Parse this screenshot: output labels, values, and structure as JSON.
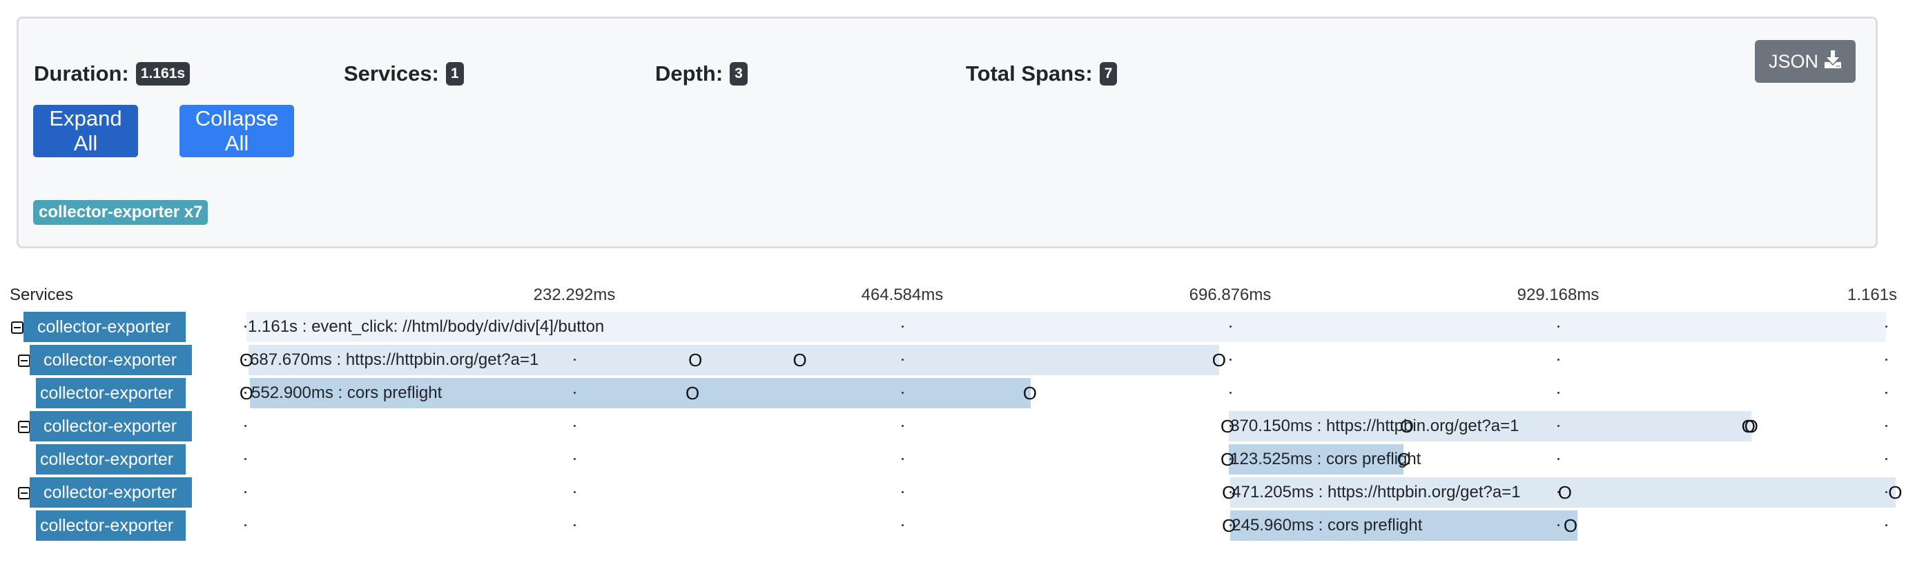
{
  "summary": {
    "duration_label": "Duration:",
    "duration_value": "1.161s",
    "services_label": "Services:",
    "services_value": "1",
    "depth_label": "Depth:",
    "depth_value": "3",
    "total_spans_label": "Total Spans:",
    "total_spans_value": "7"
  },
  "toolbar": {
    "expand_all_label": "Expand All",
    "collapse_all_label": "Collapse All",
    "json_label": "JSON",
    "json_icon": "download-icon"
  },
  "service_tags": [
    {
      "label": "collector-exporter x7",
      "color": "#4ba3b7"
    }
  ],
  "timeline": {
    "services_header": "Services",
    "total_ms": 1161.46,
    "ticks": [
      {
        "label": "232.292ms",
        "ms": 232.292
      },
      {
        "label": "464.584ms",
        "ms": 464.584
      },
      {
        "label": "696.876ms",
        "ms": 696.876
      },
      {
        "label": "929.168ms",
        "ms": 929.168
      },
      {
        "label": "1.161s",
        "ms": 1161.46
      }
    ],
    "colors": {
      "service": "#3682b4",
      "depth0": "#eef3fa",
      "depth1": "#dde8f3",
      "depth2": "#bcd4e8"
    },
    "spans": [
      {
        "service": "collector-exporter",
        "depth": 0,
        "collapsible": true,
        "start_ms": 0,
        "duration_ms": 1161.46,
        "label": "1.161s : event_click: //html/body/div/div[4]/button",
        "logs_ms": []
      },
      {
        "service": "collector-exporter",
        "depth": 1,
        "collapsible": true,
        "start_ms": 1.5,
        "duration_ms": 687.67,
        "label": "687.670ms : https://httpbin.org/get?a=1",
        "logs_ms": [
          0,
          318,
          392,
          689
        ]
      },
      {
        "service": "collector-exporter",
        "depth": 2,
        "collapsible": false,
        "start_ms": 2.5,
        "duration_ms": 552.9,
        "label": "552.900ms : cors preflight",
        "logs_ms": [
          0,
          316,
          555
        ]
      },
      {
        "service": "collector-exporter",
        "depth": 1,
        "collapsible": true,
        "start_ms": 696.0,
        "duration_ms": 370.15,
        "label": "370.150ms : https://httpbin.org/get?a=1",
        "logs_ms": [
          695,
          822,
          1064,
          1066
        ]
      },
      {
        "service": "collector-exporter",
        "depth": 2,
        "collapsible": false,
        "start_ms": 696.0,
        "duration_ms": 123.525,
        "label": "123.525ms : cors preflight",
        "logs_ms": [
          695,
          820
        ]
      },
      {
        "service": "collector-exporter",
        "depth": 1,
        "collapsible": true,
        "start_ms": 697.0,
        "duration_ms": 471.205,
        "label": "471.205ms : https://httpbin.org/get?a=1",
        "logs_ms": [
          696,
          934,
          1168
        ]
      },
      {
        "service": "collector-exporter",
        "depth": 2,
        "collapsible": false,
        "start_ms": 697.0,
        "duration_ms": 245.96,
        "label": "245.960ms : cors preflight",
        "logs_ms": [
          696,
          938
        ]
      }
    ]
  }
}
